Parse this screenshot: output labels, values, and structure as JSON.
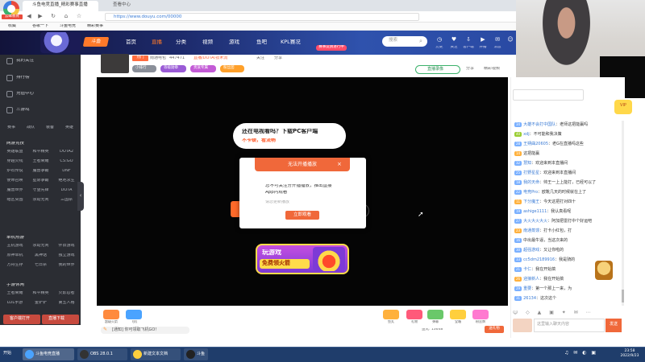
{
  "browser": {
    "logo_label": "云峰教育",
    "tabs": [
      "斗鱼电竞直播_精彩赛事直播",
      "查看中心"
    ],
    "url": "https://www.douyu.com/00000",
    "bookmarks": [
      "收藏",
      "谷歌一下",
      "斗鱼电竞",
      "精彩赛事"
    ]
  },
  "header": {
    "logo_text": "斗鱼",
    "nav": [
      "首页",
      "直播",
      "分类",
      "视频",
      "游戏",
      "鱼吧",
      "KPL赛况"
    ],
    "active_nav_index": 1,
    "kpl_badge": "赛事竞猜进行中",
    "search_placeholder": "搜索",
    "icons": [
      {
        "icon": "history-icon",
        "label": "历史"
      },
      {
        "icon": "follow-icon",
        "label": "关注"
      },
      {
        "icon": "download-icon",
        "label": "客户端"
      },
      {
        "icon": "live-icon",
        "label": "开播"
      },
      {
        "icon": "message-icon",
        "label": "消息"
      },
      {
        "icon": "user-icon",
        "label": "登录"
      }
    ]
  },
  "sidebar": {
    "top_items": [
      "我的关注",
      "排行榜",
      "充值中心",
      "三游戏"
    ],
    "quick_icons": [
      "赛事",
      "战队",
      "装备",
      "英雄"
    ],
    "sections": [
      {
        "title": "网游竞技",
        "cells": [
          "英雄联盟",
          "和平精英",
          "DOTA2",
          "穿越火线",
          "王者荣耀",
          "CS:GO",
          "炉石传说",
          "魔兽争霸",
          "DNF",
          "使命召唤",
          "星际争霸",
          "绝地求生",
          "魔兽世界",
          "守望先锋",
          "DOTA",
          "暗区突围",
          "永劫无间",
          "三国杀"
        ]
      },
      {
        "title": "单机热游",
        "cells": [
          "主机游戏",
          "永劫无间",
          "怀旧游戏",
          "原神单机",
          "黑神话",
          "独立游戏",
          "方舟生存",
          "七日杀",
          "我的世界"
        ]
      },
      {
        "title": "手游休闲",
        "cells": [
          "王者荣耀",
          "和平精英",
          "火影忍者",
          "LOL手游",
          "金铲铲",
          "第五人格"
        ]
      }
    ],
    "bottom_buttons": [
      "客户端打开",
      "直播下载"
    ]
  },
  "room": {
    "hot_label": "热门",
    "streamer": "南通电包",
    "heat": "447471",
    "category": "直播/DOTA/技术流",
    "actions": [
      "关注",
      "分享"
    ],
    "tags": [
      {
        "text": "小排行",
        "color": "#8a8f99"
      },
      {
        "text": "等级勋章",
        "color": "#9a5bd6"
      },
      {
        "text": "贵族专属",
        "color": "#c35bd6"
      },
      {
        "text": "粉丝团",
        "color": "#ffa02a"
      }
    ],
    "live_btn": "直播录像",
    "right_links": [
      "分享",
      "精彩视频"
    ]
  },
  "video": {
    "bubble_line1": "还在电视看吗？下载PC客户端",
    "bubble_line2": "不卡顿，看流畅",
    "dialog": {
      "title": "无法开播播放",
      "close": "×",
      "text1": "您不可关注分开播播放，推出直接",
      "text2": "App内观看",
      "text3": "请您更新播放",
      "button": "立即观看"
    },
    "promo_line1": "玩游戏",
    "promo_line2": "免费领火箭"
  },
  "toolbar": {
    "gifts": [
      {
        "label": "超级火箭",
        "color": "#ff8a3d"
      },
      {
        "label": "飞机",
        "color": "#4aa3ff"
      },
      {
        "label": "鱼丸",
        "color": "#ffb13d"
      },
      {
        "label": "礼物",
        "color": "#ff5a7a"
      },
      {
        "label": "弹幕",
        "color": "#6ac86a"
      },
      {
        "label": "宝箱",
        "color": "#ffcf3d"
      },
      {
        "label": "粉丝牌",
        "color": "#ff7ad0"
      }
    ],
    "notice": "[通知] 你可领取飞机GO！",
    "stats": "鱼丸: 13648",
    "gift_btn": "送礼物"
  },
  "chat": {
    "vip_badge": "VIP",
    "messages": [
      {
        "lv": "34",
        "lvcolor": "#7ab0ff",
        "user": "大雄不会打中国队",
        "msg": "：老师这把能赢吗"
      },
      {
        "lv": "40",
        "lvcolor": "#9acd32",
        "user": "xdj",
        "msg": "：不可能和我决策"
      },
      {
        "lv": "28",
        "lvcolor": "#7ab0ff",
        "user": "王朔曲20605",
        "msg": "：老G在直播吗这些"
      },
      {
        "lv": "14",
        "lvcolor": "#ffb13d",
        "user": "",
        "msg": "这把能赢"
      },
      {
        "lv": "32",
        "lvcolor": "#7ab0ff",
        "user": "慧知",
        "msg": "：欢迎来到本直播间"
      },
      {
        "lv": "25",
        "lvcolor": "#7ab0ff",
        "user": "打野星星",
        "msg": "：欢迎来到本直播间"
      },
      {
        "lv": "18",
        "lvcolor": "#7ab0ff",
        "user": "我的天命",
        "msg": "：帅王一上上能打，已经可以了"
      },
      {
        "lv": "22",
        "lvcolor": "#7ab0ff",
        "user": "电竞Pro",
        "msg": "：欧靴几天的时候就在上了"
      },
      {
        "lv": "11",
        "lvcolor": "#ffb13d",
        "user": "下分魔王",
        "msg": "：今天这把打对四十"
      },
      {
        "lv": "19",
        "lvcolor": "#7ab0ff",
        "user": "ashige1111",
        "msg": "：我认真看呢"
      },
      {
        "lv": "27",
        "lvcolor": "#7ab0ff",
        "user": "大火大火大火",
        "msg": "：阿加把雷打中个好运吧"
      },
      {
        "lv": "23",
        "lvcolor": "#ffb13d",
        "user": "南通蒸馒",
        "msg": "：打卡小红包，打"
      },
      {
        "lv": "16",
        "lvcolor": "#7ab0ff",
        "user": "",
        "msg": "中出最牛逼，当这次来的"
      },
      {
        "lv": "30",
        "lvcolor": "#7ab0ff",
        "user": "超强游戏",
        "msg": "：又让你啦的"
      },
      {
        "lv": "33",
        "lvcolor": "#7ab0ff",
        "user": "cc5dm2189916",
        "msg": "：我是骑的"
      },
      {
        "lv": "21",
        "lvcolor": "#7ab0ff",
        "user": "卡仁",
        "msg": "：我在开始搞"
      },
      {
        "lv": "26",
        "lvcolor": "#ffb13d",
        "user": "迎接新人",
        "msg": "：我在开始搞"
      },
      {
        "lv": "29",
        "lvcolor": "#7ab0ff",
        "user": "重要",
        "msg": "：第一个那上一来，为"
      },
      {
        "lv": "31",
        "lvcolor": "#7ab0ff",
        "user": "26134",
        "msg": "：这次这个"
      }
    ],
    "tools": "☺ ◇ ▲ ▣ ✦ ✉ ⋯",
    "input_placeholder": "这里输入聊天内容",
    "send": "发送"
  },
  "taskbar": {
    "start": "开始",
    "tasks": [
      {
        "label": "斗鱼电竞直播",
        "color": "#4aa3ff"
      },
      {
        "label": "OBS 28.0.1",
        "color": "#333"
      },
      {
        "label": "新建文本文档",
        "color": "#ffcf3d"
      },
      {
        "label": "斗鱼",
        "color": "#222"
      }
    ],
    "tray": "♫ ✉ ◐ ▣",
    "time": "23:58",
    "date": "2022/9/23"
  }
}
